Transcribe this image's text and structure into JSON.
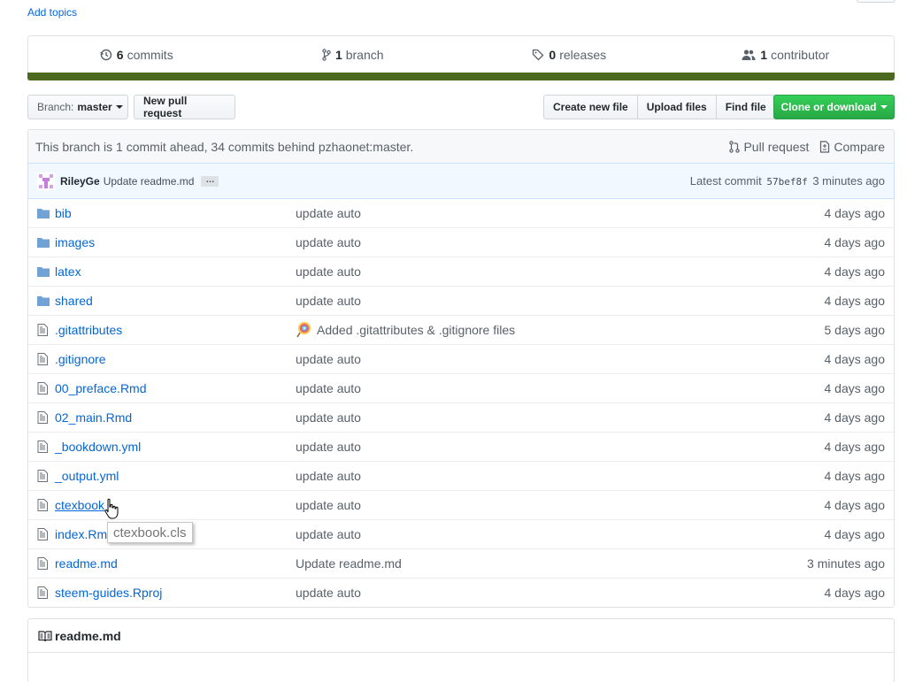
{
  "topics": {
    "add_label": "Add topics"
  },
  "numbers": {
    "commits": {
      "count": "6",
      "label": "commits",
      "icon": "history-icon"
    },
    "branch": {
      "count": "1",
      "label": "branch",
      "icon": "branch-icon"
    },
    "releases": {
      "count": "0",
      "label": "releases",
      "icon": "tag-icon"
    },
    "contributors": {
      "count": "1",
      "label": "contributor",
      "icon": "people-icon"
    },
    "language_color": "#4b6a1f"
  },
  "toolbar": {
    "branch_prefix": "Branch:",
    "branch_name": "master",
    "new_pr": "New pull request",
    "create_file": "Create new file",
    "upload_files": "Upload files",
    "find_file": "Find file",
    "clone": "Clone or download",
    "clone_color": "#28a745"
  },
  "branch_info": {
    "message": "This branch is 1 commit ahead, 34 commits behind pzhaonet:master.",
    "pull_request": "Pull request",
    "compare": "Compare"
  },
  "commit": {
    "author": "RileyGe",
    "message": "Update readme.md",
    "ellipsis": "…",
    "latest_label": "Latest commit",
    "sha": "57bef8f",
    "age": "3 minutes ago"
  },
  "files": [
    {
      "type": "dir",
      "name": "bib",
      "message": "update auto",
      "age": "4 days ago"
    },
    {
      "type": "dir",
      "name": "images",
      "message": "update auto",
      "age": "4 days ago"
    },
    {
      "type": "dir",
      "name": "latex",
      "message": "update auto",
      "age": "4 days ago"
    },
    {
      "type": "dir",
      "name": "shared",
      "message": "update auto",
      "age": "4 days ago"
    },
    {
      "type": "file",
      "name": ".gitattributes",
      "message": "Added .gitattributes & .gitignore files",
      "age": "5 days ago"
    },
    {
      "type": "file",
      "name": ".gitignore",
      "message": "update auto",
      "age": "4 days ago"
    },
    {
      "type": "file",
      "name": "00_preface.Rmd",
      "message": "update auto",
      "age": "4 days ago"
    },
    {
      "type": "file",
      "name": "02_main.Rmd",
      "message": "update auto",
      "age": "4 days ago"
    },
    {
      "type": "file",
      "name": "_bookdown.yml",
      "message": "update auto",
      "age": "4 days ago"
    },
    {
      "type": "file",
      "name": "_output.yml",
      "message": "update auto",
      "age": "4 days ago"
    },
    {
      "type": "file",
      "name": "ctexbook",
      "message": "update auto",
      "age": "4 days ago"
    },
    {
      "type": "file",
      "name": "index.Rmd",
      "message": "update auto",
      "age": "4 days ago"
    },
    {
      "type": "file",
      "name": "readme.md",
      "message": "Update readme.md",
      "age": "3 minutes ago"
    },
    {
      "type": "file",
      "name": "steem-guides.Rproj",
      "message": "update auto",
      "age": "4 days ago"
    }
  ],
  "tooltip": {
    "text": "ctexbook.cls"
  },
  "readme": {
    "title": "readme.md",
    "icon": "book-icon"
  }
}
